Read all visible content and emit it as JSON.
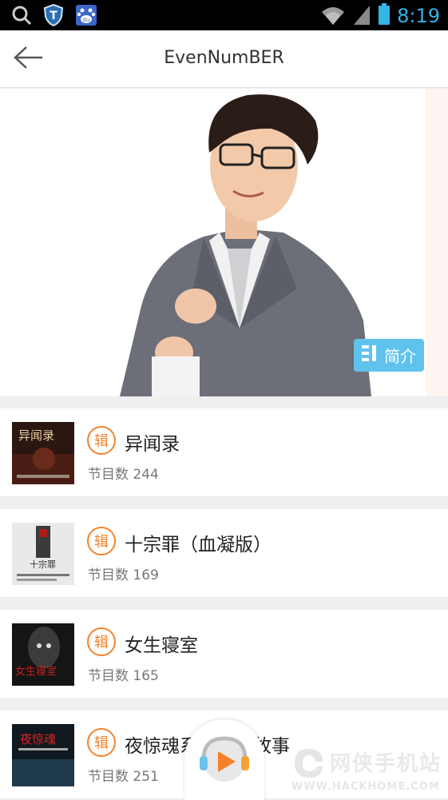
{
  "status_bar": {
    "time": "8:19",
    "icons": [
      "search-icon",
      "shield-t-icon",
      "baidu-paw-icon",
      "wifi-icon",
      "signal-icon",
      "battery-icon"
    ],
    "color": "#33b5e5"
  },
  "header": {
    "title": "EvenNumBER",
    "back_icon": "back-arrow-icon"
  },
  "hero": {
    "intro_button_label": "简介",
    "intro_icon": "list-icon",
    "intro_color": "#5fc3ee"
  },
  "albums": [
    {
      "tag": "辑",
      "title": "异闻录",
      "count": "节目数 244",
      "cover_text": "异闻录"
    },
    {
      "tag": "辑",
      "title": "十宗罪（血凝版）",
      "count": "节目数 169",
      "cover_text": "十宗罪"
    },
    {
      "tag": "辑",
      "title": "女生寝室",
      "count": "节目数 165",
      "cover_text": "女生寝室"
    },
    {
      "tag": "辑",
      "title": "夜惊魂系列恐怖故事",
      "count": "节目数 251",
      "cover_text": "夜惊魂"
    }
  ],
  "accent_color": "#f5822a",
  "player": {
    "icon": "play-icon"
  },
  "watermark": {
    "top": "网侠手机站",
    "bottom": "WWW.HACKHOME.COM"
  }
}
